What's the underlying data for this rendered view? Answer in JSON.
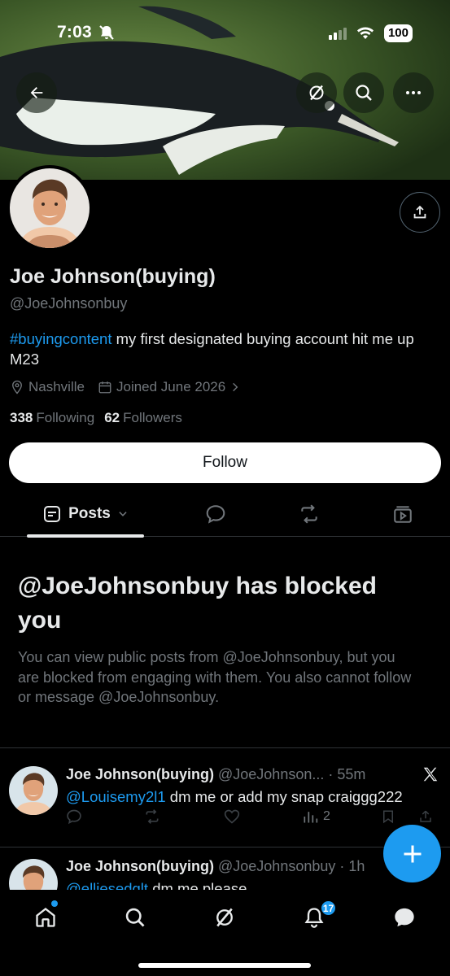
{
  "status_bar": {
    "time": "7:03",
    "battery": "100"
  },
  "header": {
    "back_icon": "arrow-left-icon",
    "grok_icon": "slash-circle-icon",
    "search_icon": "search-icon",
    "more_icon": "more-horizontal-icon"
  },
  "profile": {
    "name": "Joe Johnson(buying)",
    "handle": "@JoeJohnsonbuy",
    "bio_hashtag": "#buyingcontent",
    "bio_text": " my first designated buying account hit me up M23",
    "location": "Nashville",
    "joined": "Joined June 2026",
    "following_count": "338",
    "following_label": "Following",
    "followers_count": "62",
    "followers_label": "Followers",
    "follow_label": "Follow"
  },
  "tabs": {
    "posts_label": "Posts"
  },
  "blocked": {
    "title": "@JoeJohnsonbuy has blocked you",
    "description": "You can view public posts from @JoeJohnsonbuy, but you are blocked from engaging with them. You also cannot follow or message @JoeJohnsonbuy."
  },
  "posts": [
    {
      "name": "Joe Johnson(buying)",
      "handle_time": " @JoeJohnson... · 55m",
      "mention": "@Louisemy2l1",
      "text": " dm me or add my snap craiggg222",
      "views": "2"
    },
    {
      "name": "Joe Johnson(buying)",
      "handle_time": " @JoeJohnsonbuy · 1h",
      "mention": "@elliesedglt",
      "text": " dm me please"
    }
  ],
  "bottom_nav": {
    "notifications_badge": "17"
  },
  "colors": {
    "accent": "#1d9bf0",
    "background": "#000000",
    "secondary_text": "#71767b"
  }
}
